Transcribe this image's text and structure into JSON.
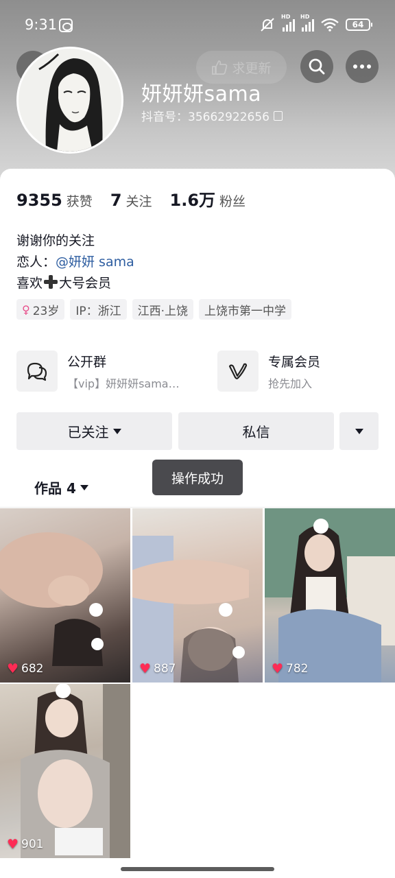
{
  "status_bar": {
    "time": "9:31",
    "battery": "64",
    "hd_label": "HD"
  },
  "header": {
    "update_chip": "求更新",
    "nickname": "妍妍妍sama",
    "douyin_id": "抖音号：35662922656"
  },
  "stats": [
    {
      "value": "9355",
      "label": "获赞"
    },
    {
      "value": "7",
      "label": "关注"
    },
    {
      "value": "1.6万",
      "label": "粉丝"
    }
  ],
  "bio": {
    "line1": "谢谢你的关注",
    "line2_prefix": "恋人：",
    "line2_mention": "@妍妍 sama",
    "line3_before": "喜欢",
    "line3_after": "大号会员"
  },
  "tags": {
    "age": "23岁",
    "ip": "IP：浙江",
    "location": "江西·上饶",
    "school": "上饶市第一中学"
  },
  "entries": {
    "group_title": "公开群",
    "group_sub": "【vip】妍妍妍sama…",
    "vip_title": "专属会员",
    "vip_sub": "抢先加入"
  },
  "actions": {
    "follow_label": "已关注",
    "message_label": "私信"
  },
  "works_tab": "作品 4",
  "toast": "操作成功",
  "videos": [
    {
      "likes": "682"
    },
    {
      "likes": "887"
    },
    {
      "likes": "782"
    },
    {
      "likes": "901"
    }
  ],
  "colors": {
    "accent_like": "#fe2c55",
    "mention": "#2d5da0",
    "toast_bg": "#4a4a4e"
  }
}
